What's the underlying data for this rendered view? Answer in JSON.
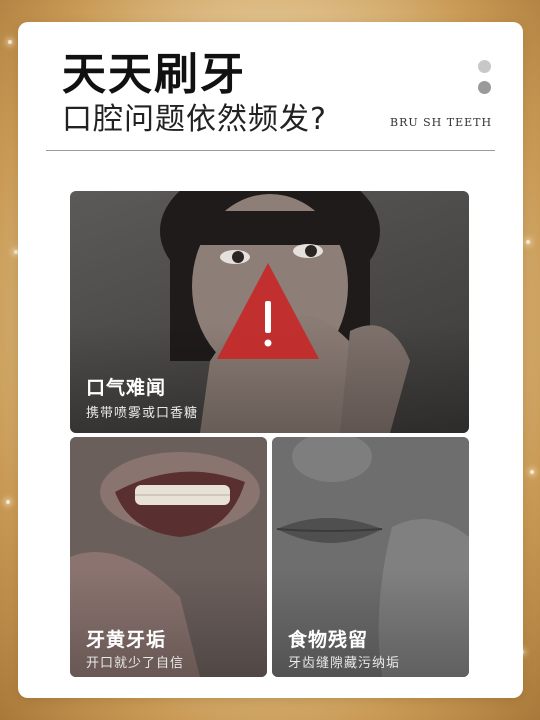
{
  "header": {
    "title": "天天刷牙",
    "subtitle": "口腔问题依然频发?",
    "brand": "BRU SH TEETH"
  },
  "tiles": [
    {
      "heading": "口气难闻",
      "caption": "携带喷雾或口香糖"
    },
    {
      "heading": "牙黄牙垢",
      "caption": "开口就少了自信"
    },
    {
      "heading": "食物残留",
      "caption": "牙齿缝隙藏污纳垢"
    }
  ],
  "colors": {
    "warning_red": "#c62828",
    "card_background": "#ffffff",
    "frame_gold": "#c99a55"
  },
  "icons": [
    "warning-triangle-icon",
    "menu-dots-icon"
  ]
}
